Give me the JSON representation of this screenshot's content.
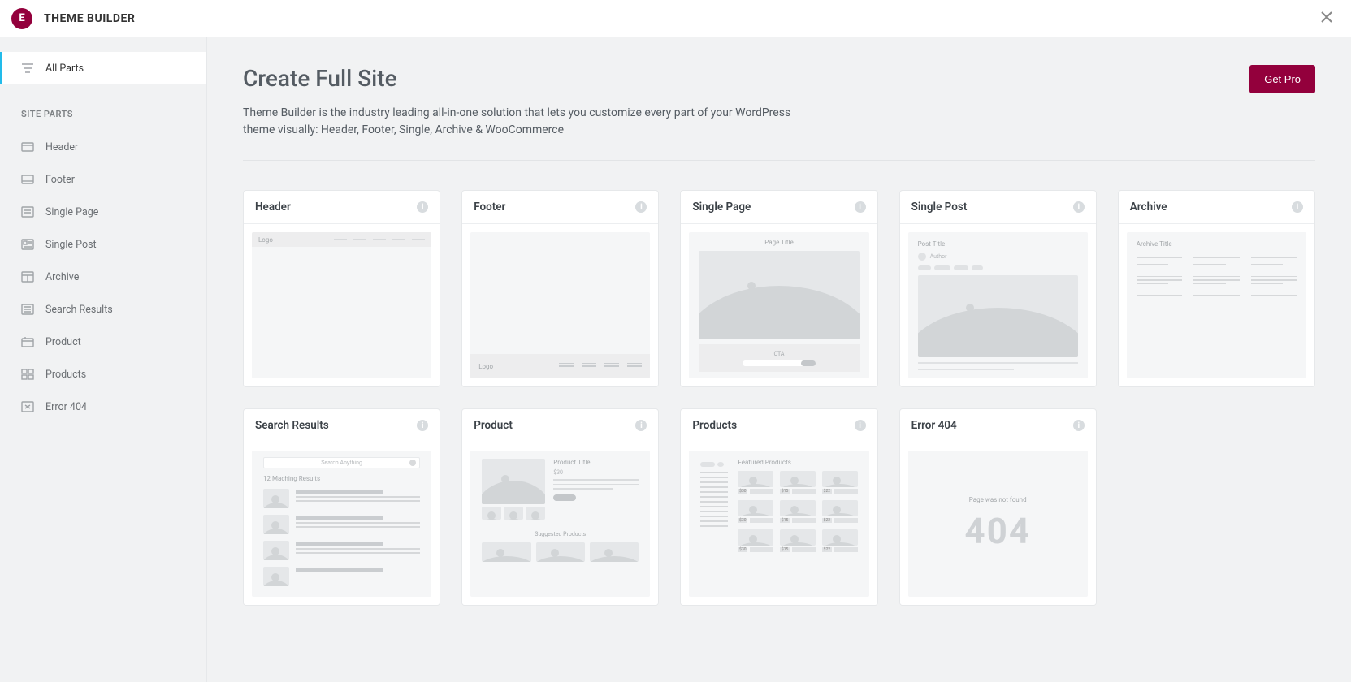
{
  "app": {
    "title": "THEME BUILDER",
    "logo_letter": "E"
  },
  "sidebar": {
    "all_parts": "All Parts",
    "section_label": "SITE PARTS",
    "items": [
      {
        "label": "Header"
      },
      {
        "label": "Footer"
      },
      {
        "label": "Single Page"
      },
      {
        "label": "Single Post"
      },
      {
        "label": "Archive"
      },
      {
        "label": "Search Results"
      },
      {
        "label": "Product"
      },
      {
        "label": "Products"
      },
      {
        "label": "Error 404"
      }
    ]
  },
  "hero": {
    "title": "Create Full Site",
    "description": "Theme Builder is the industry leading all-in-one solution that lets you customize every part of your WordPress theme visually: Header, Footer, Single, Archive & WooCommerce",
    "cta": "Get Pro"
  },
  "cards": [
    {
      "title": "Header"
    },
    {
      "title": "Footer"
    },
    {
      "title": "Single Page"
    },
    {
      "title": "Single Post"
    },
    {
      "title": "Archive"
    },
    {
      "title": "Search Results"
    },
    {
      "title": "Product"
    },
    {
      "title": "Products"
    },
    {
      "title": "Error 404"
    }
  ],
  "wf": {
    "logo": "Logo",
    "page_title": "Page Title",
    "cta": "CTA",
    "post_title": "Post Title",
    "author": "Author",
    "archive_title": "Archive Title",
    "search_placeholder": "Search Anything",
    "search_results": "12 Maching Results",
    "product_title": "Product Title",
    "product_price": "$30",
    "suggested": "Suggested Products",
    "featured": "Featured Products",
    "p1": "$30",
    "p2": "$15",
    "p3": "$22",
    "p4": "$30",
    "p5": "$15",
    "p6": "$22",
    "p7": "$30",
    "p8": "$15",
    "p9": "$22",
    "not_found": "Page was not found",
    "err_code": "404"
  }
}
